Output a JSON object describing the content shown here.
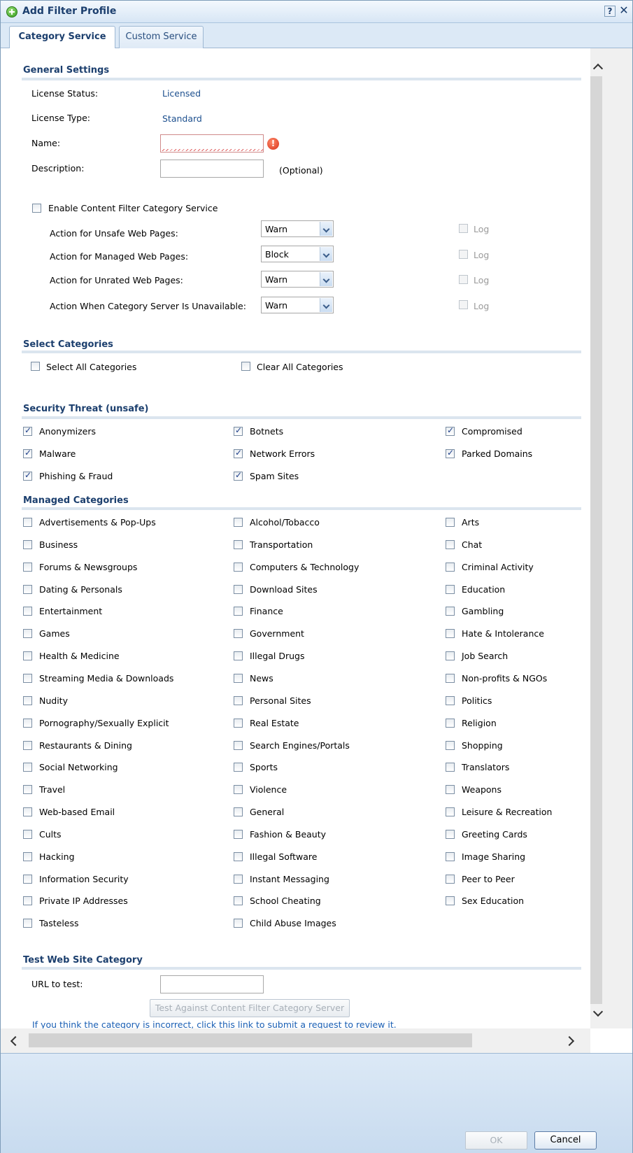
{
  "dialog": {
    "title": "Add Filter Profile",
    "help_label": "?",
    "close_label": "✕"
  },
  "tabs": [
    {
      "label": "Category Service",
      "active": true
    },
    {
      "label": "Custom Service",
      "active": false
    }
  ],
  "general": {
    "title": "General Settings",
    "license_status_label": "License Status:",
    "license_status_value": "Licensed",
    "license_type_label": "License Type:",
    "license_type_value": "Standard",
    "name_label": "Name:",
    "name_value": "",
    "description_label": "Description:",
    "description_value": "",
    "optional_label": "(Optional)",
    "enable_label": "Enable Content Filter Category Service",
    "actions": [
      {
        "label": "Action for Unsafe Web Pages:",
        "value": "Warn",
        "log": "Log"
      },
      {
        "label": "Action for Managed Web Pages:",
        "value": "Block",
        "log": "Log"
      },
      {
        "label": "Action for Unrated Web Pages:",
        "value": "Warn",
        "log": "Log"
      },
      {
        "label": "Action When Category Server Is Unavailable:",
        "value": "Warn",
        "log": "Log"
      }
    ]
  },
  "select_categories": {
    "title": "Select Categories",
    "select_all": "Select All Categories",
    "clear_all": "Clear All Categories"
  },
  "security_threat": {
    "title": "Security Threat (unsafe)",
    "items": [
      "Anonymizers",
      "Botnets",
      "Compromised",
      "Malware",
      "Network Errors",
      "Parked Domains",
      "Phishing & Fraud",
      "Spam Sites"
    ]
  },
  "managed": {
    "title": "Managed Categories",
    "items": [
      "Advertisements & Pop-Ups",
      "Alcohol/Tobacco",
      "Arts",
      "Business",
      "Transportation",
      "Chat",
      "Forums & Newsgroups",
      "Computers & Technology",
      "Criminal Activity",
      "Dating & Personals",
      "Download Sites",
      "Education",
      "Entertainment",
      "Finance",
      "Gambling",
      "Games",
      "Government",
      "Hate & Intolerance",
      "Health & Medicine",
      "Illegal Drugs",
      "Job Search",
      "Streaming Media & Downloads",
      "News",
      "Non-profits & NGOs",
      "Nudity",
      "Personal Sites",
      "Politics",
      "Pornography/Sexually Explicit",
      "Real Estate",
      "Religion",
      "Restaurants & Dining",
      "Search Engines/Portals",
      "Shopping",
      "Social Networking",
      "Sports",
      "Translators",
      "Travel",
      "Violence",
      "Weapons",
      "Web-based Email",
      "General",
      "Leisure & Recreation",
      "Cults",
      "Fashion & Beauty",
      "Greeting Cards",
      "Hacking",
      "Illegal Software",
      "Image Sharing",
      "Information Security",
      "Instant Messaging",
      "Peer to Peer",
      "Private IP Addresses",
      "School Cheating",
      "Sex Education",
      "Tasteless",
      "Child Abuse Images"
    ]
  },
  "test": {
    "title": "Test Web Site Category",
    "url_label": "URL to test:",
    "url_value": "",
    "test_button": "Test Against Content Filter Category Server",
    "link": "If you think the category is incorrect, click this link to submit a request to review it."
  },
  "footer": {
    "ok_label": "OK",
    "cancel_label": "Cancel"
  }
}
